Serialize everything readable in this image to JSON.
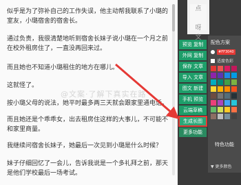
{
  "article": {
    "paragraphs": [
      "似乎是为了弥补自己的工作失误，他主动帮我联系了小璐的室友，小璐宿舍的宿舍长。",
      "通过负责，我很清楚地听到宿舍长妹子说小璐在一个月之前在校外租房住了，一直没再回来过。",
      "而且她也不知道小璐租住的地方在哪儿。",
      "这就怪了。",
      "按小璐父母的说法，她平时最多两三天就会跟家里通电话。",
      "而且她还是个乖乖女，出去租房住这样的大事儿，不可能不和家里商量。",
      "我继续问宿舍长妹子，她最后一次见到小璐是什么时候？",
      "妹子仔细回忆了一会儿，告诉我说是一个多礼拜之前，那天是他们学校最后一场考试。"
    ],
    "watermark": "@文案·了解下真实在路"
  },
  "corner_chip": "点\n\n呀\n文",
  "sidebar": {
    "buttons": [
      "预览 复制",
      "外网 复制",
      "保存 文章",
      "导入 文章",
      "图文 新建",
      "手机 预览",
      "云端草稿",
      "生成长图",
      "更多功能"
    ],
    "active_index": 7
  },
  "panel": {
    "title": "配色方案",
    "tag_label": "#FF3040",
    "checkbox_label": "适度色彩",
    "more_colors_label": "▼ 更多颜色",
    "swatches": [
      "#e53935",
      "#ef5350",
      "#d81b60",
      "#c2185b",
      "#8e24aa",
      "#5e35b1",
      "#1e88e5",
      "#039be5",
      "#00acc1",
      "#00897b",
      "#43a047",
      "#7cb342",
      "#fdd835",
      "#ffb300",
      "#fb8c00",
      "#f4511e",
      "#6d4c41",
      "#757575",
      "#546e7a",
      "#263238",
      "#ec407a",
      "#ab47bc",
      "#42a5f5",
      "#26c6da",
      "#66bb6a",
      "#d4e157",
      "#ffca28",
      "#ff7043",
      "#8d6e63",
      "#bdbdbd",
      "#78909c",
      "#424242"
    ]
  },
  "feature_label": "特色功能",
  "colors": {
    "button_green": "#1e9e6a",
    "highlight_red": "#e53935"
  }
}
